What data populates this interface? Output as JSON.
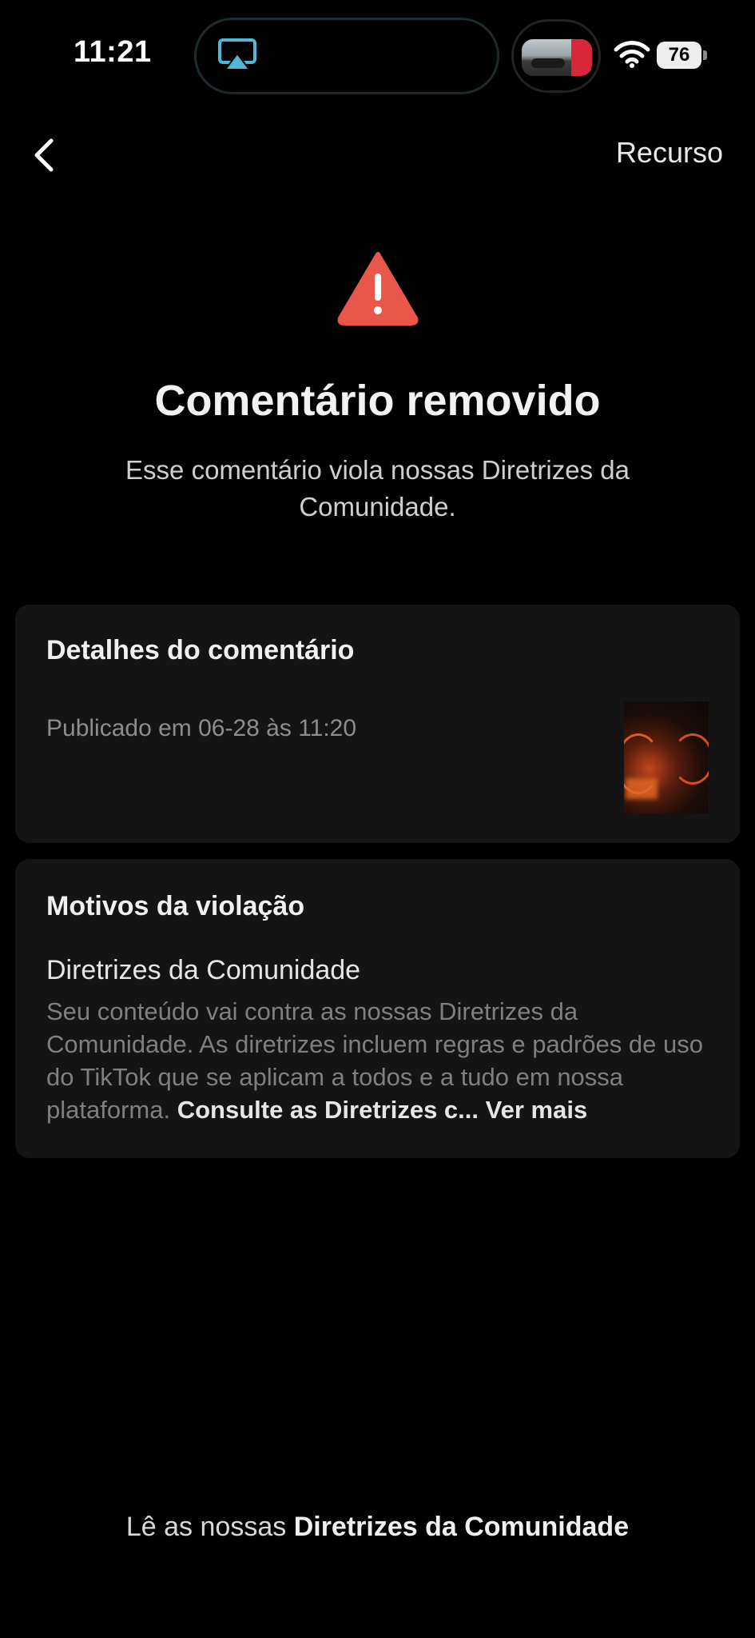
{
  "status_bar": {
    "time": "11:21",
    "battery_level": "76"
  },
  "header": {
    "appeal_label": "Recurso"
  },
  "warning": {
    "title": "Comentário removido",
    "subtitle": "Esse comentário viola nossas Diretrizes da Comunidade."
  },
  "details_card": {
    "title": "Detalhes do comentário",
    "published": "Publicado em 06-28 às 11:20"
  },
  "reasons_card": {
    "title": "Motivos da violação",
    "guideline_title": "Diretrizes da Comunidade",
    "guideline_text": "Seu conteúdo vai contra as nossas Diretrizes da Comunidade. As diretrizes incluem regras e padrões de uso do TikTok que se aplicam a todos e a tudo em nossa plataforma.",
    "consult_link": "Consulte as Diretrizes c...",
    "see_more": "Ver mais"
  },
  "footer": {
    "prefix": "Lê as nossas",
    "link": "Diretrizes da Comunidade"
  },
  "colors": {
    "background": "#000000",
    "card": "#141414",
    "warning": "#e8574a",
    "airplay": "#4fb8d9"
  }
}
